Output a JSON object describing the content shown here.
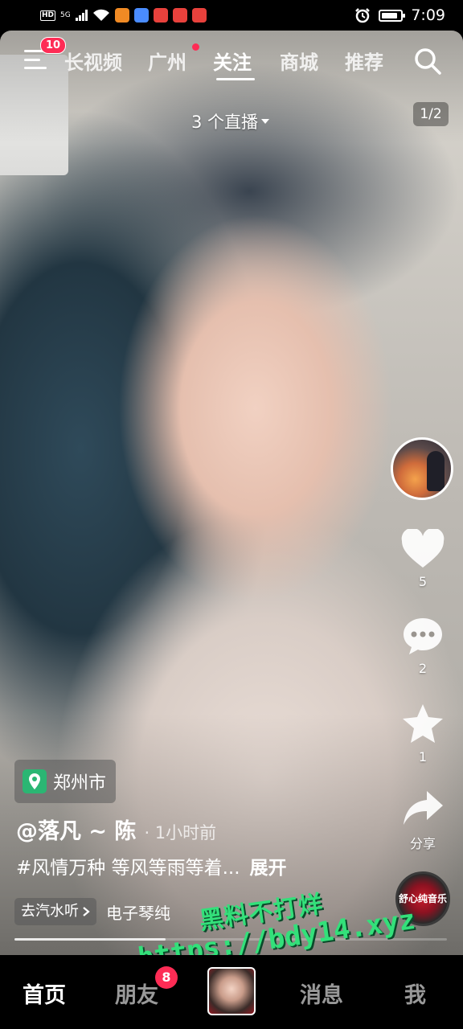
{
  "status_bar": {
    "left_badges": [
      "HD",
      "5G"
    ],
    "time": "7:09",
    "battery_level": 0.85,
    "app_icon_colors": [
      "#f08a24",
      "#4a8cff",
      "#e8413c",
      "#e8413c",
      "#e8413c"
    ]
  },
  "top_nav": {
    "menu_badge": "10",
    "tabs": [
      {
        "label": "长视频"
      },
      {
        "label": "广州"
      },
      {
        "label": "关注"
      },
      {
        "label": "商城"
      },
      {
        "label": "推荐"
      }
    ],
    "active_tab": "关注"
  },
  "live": {
    "label": "3 个直播"
  },
  "page_indicator": "1/2",
  "actions": {
    "like_count": "5",
    "comment_count": "2",
    "favorite_count": "1",
    "share_label": "分享"
  },
  "post": {
    "location": "郑州市",
    "author": "@落凡 ~ 陈",
    "time": "· 1小时前",
    "caption": "#风情万种 等风等雨等着...",
    "expand_label": "展开",
    "go_button": "去汽水听",
    "music_title": "电子琴纯",
    "disc_label": "舒心纯音乐",
    "progress": 0.35
  },
  "watermark": {
    "line1": "黑料不打烊",
    "line2": "https://bdy14.xyz"
  },
  "tab_bar": {
    "tabs": [
      {
        "label": "首页"
      },
      {
        "label": "朋友"
      },
      {
        "label": "消息"
      },
      {
        "label": "我"
      }
    ],
    "friends_badge": "8",
    "active_tab": "首页"
  },
  "colors": {
    "accent": "#fe2c55",
    "location_green": "#2bb673",
    "watermark_green": "#33e07a"
  },
  "icons": [
    "menu-icon",
    "search-icon",
    "heart-icon",
    "comment-icon",
    "star-icon",
    "share-icon",
    "location-pin-icon",
    "chevron-right-icon",
    "caret-down-icon"
  ]
}
